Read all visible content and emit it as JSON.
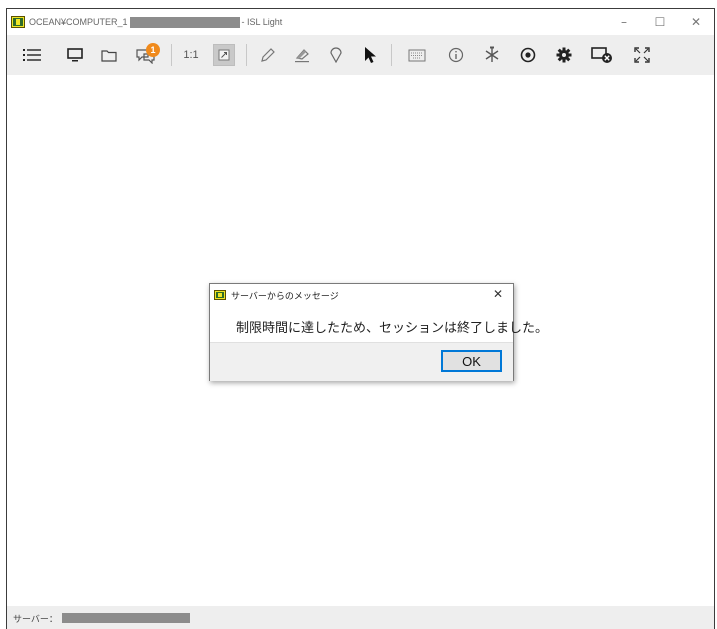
{
  "window": {
    "title_prefix": "OCEAN¥COMPUTER_1",
    "title_suffix": "- ISL Light",
    "minimize": "–",
    "maximize": "☐",
    "close": "✕"
  },
  "toolbar": {
    "chat_badge_count": "1",
    "ratio_label": "1:1"
  },
  "dialog": {
    "title": "サーバーからのメッセージ",
    "close": "✕",
    "message": "制限時間に達したため、セッションは終了しました。",
    "ok_label": "OK"
  },
  "statusbar": {
    "server_label": "サーバー："
  }
}
